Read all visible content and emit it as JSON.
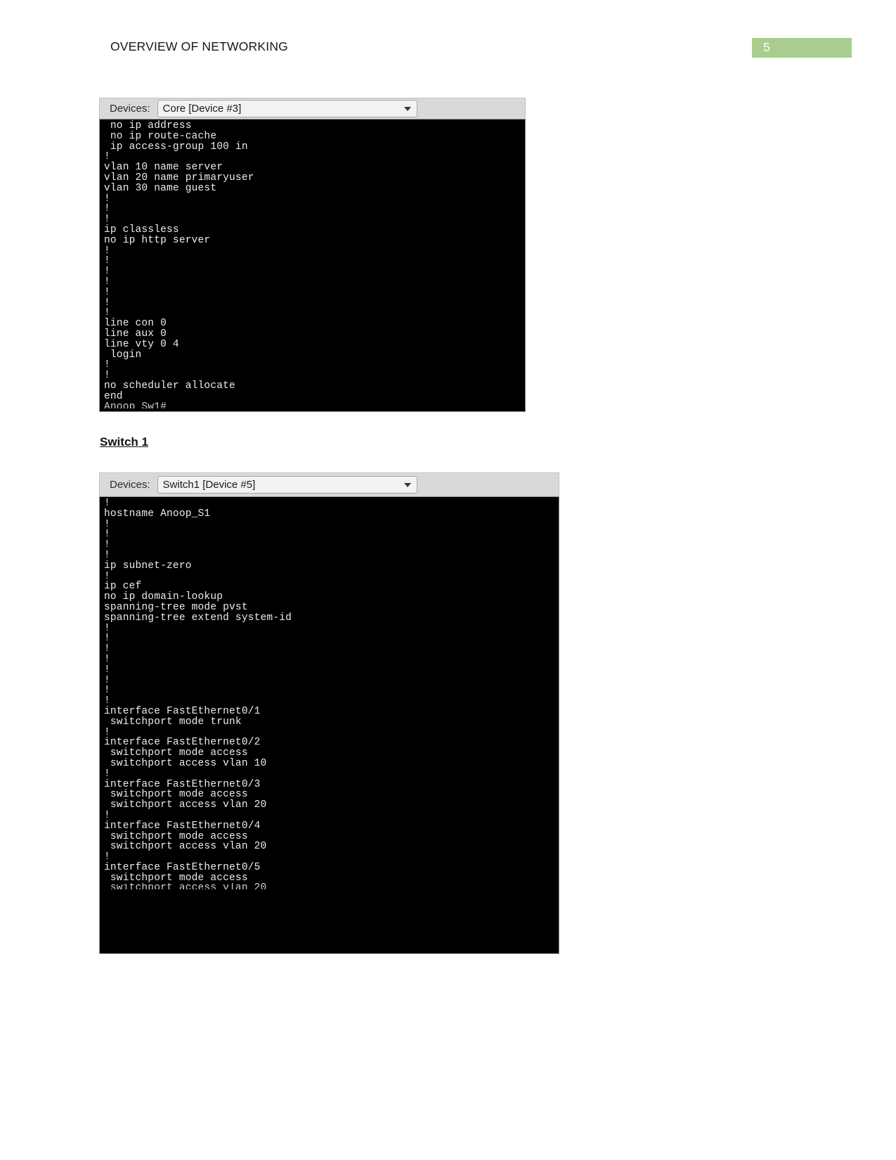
{
  "header": {
    "title": "OVERVIEW OF NETWORKING",
    "page_number": "5",
    "badge_color": "#a9cd8e"
  },
  "headings": {
    "switch1": "Switch 1"
  },
  "windows": [
    {
      "name": "core-device-window",
      "devices_label": "Devices:",
      "selected_device": "Core [Device #3]",
      "lines": [
        " no ip address",
        " no ip route-cache",
        " ip access-group 100 in",
        "!",
        "vlan 10 name server",
        "vlan 20 name primaryuser",
        "vlan 30 name guest",
        "!",
        "!",
        "!",
        "ip classless",
        "no ip http server",
        "!",
        "!",
        "!",
        "!",
        "!",
        "!",
        "!",
        "line con 0",
        "line aux 0",
        "line vty 0 4",
        " login",
        "!",
        "!",
        "no scheduler allocate",
        "end"
      ],
      "clipped_line": "Anoop_Sw1#"
    },
    {
      "name": "switch1-device-window",
      "devices_label": "Devices:",
      "selected_device": "Switch1 [Device #5]",
      "lines": [
        "!",
        "hostname Anoop_S1",
        "!",
        "!",
        "!",
        "!",
        "ip subnet-zero",
        "!",
        "ip cef",
        "no ip domain-lookup",
        "spanning-tree mode pvst",
        "spanning-tree extend system-id",
        "!",
        "!",
        "!",
        "!",
        "!",
        "!",
        "!",
        "!",
        "interface FastEthernet0/1",
        " switchport mode trunk",
        "!",
        "interface FastEthernet0/2",
        " switchport mode access",
        " switchport access vlan 10",
        "!",
        "interface FastEthernet0/3",
        " switchport mode access",
        " switchport access vlan 20",
        "!",
        "interface FastEthernet0/4",
        " switchport mode access",
        " switchport access vlan 20",
        "!",
        "interface FastEthernet0/5",
        " switchport mode access"
      ],
      "clipped_line": " switchport access vlan 20"
    }
  ]
}
